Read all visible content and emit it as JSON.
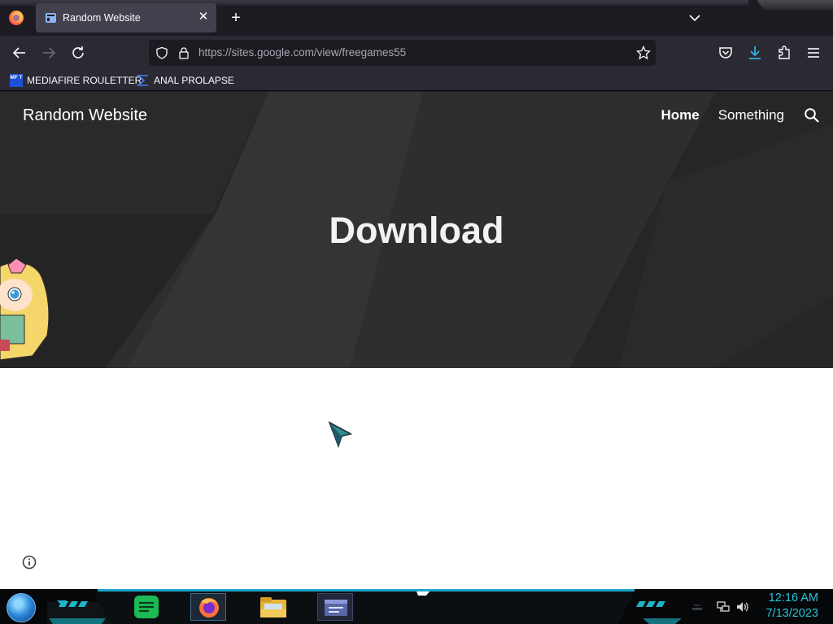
{
  "browser": {
    "tab": {
      "title": "Random Website"
    },
    "new_tab": "+",
    "close": "✕",
    "url_host": "https://sites.google.com",
    "url_path": "/view/freegames55",
    "bookmarks": [
      {
        "label": "MEDIAFIRE ROULETTER",
        "icon_text": "MF T"
      },
      {
        "label": "ANAL PROLAPSE"
      }
    ]
  },
  "site": {
    "title": "Random Website",
    "nav": [
      {
        "label": "Home"
      },
      {
        "label": "Something"
      }
    ],
    "hero_title": "Download"
  },
  "taskbar": {
    "time": "12:16 AM",
    "date": "7/13/2023",
    "apps": [
      "notes-app",
      "firefox",
      "file-explorer",
      "control-panel"
    ]
  },
  "colors": {
    "hero_bg": "#2e2e2e",
    "browser_dark": "#1c1b22",
    "toolbar": "#2b2a33",
    "clock": "#23c7d9"
  }
}
